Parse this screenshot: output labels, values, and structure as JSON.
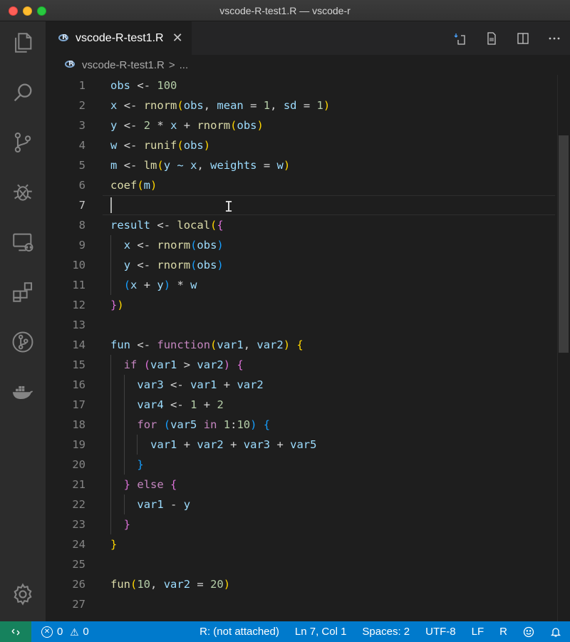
{
  "window": {
    "title": "vscode-R-test1.R — vscode-r"
  },
  "activity_bar": {
    "items": [
      {
        "icon": "files-icon"
      },
      {
        "icon": "search-icon"
      },
      {
        "icon": "source-control-icon"
      },
      {
        "icon": "debug-icon"
      },
      {
        "icon": "remote-explorer-icon"
      },
      {
        "icon": "extensions-icon"
      },
      {
        "icon": "git-graph-icon"
      },
      {
        "icon": "docker-icon"
      }
    ],
    "bottom": {
      "icon": "gear-icon"
    }
  },
  "tab": {
    "label": "vscode-R-test1.R",
    "close": "✕"
  },
  "editor_actions": [
    "run-file-icon",
    "preview-icon",
    "split-editor-icon",
    "more-actions-icon"
  ],
  "breadcrumb": {
    "file": "vscode-R-test1.R",
    "sep": ">",
    "more": "..."
  },
  "editor": {
    "current_line": 7,
    "lines": [
      "obs <- 100",
      "x <- rnorm(obs, mean = 1, sd = 1)",
      "y <- 2 * x + rnorm(obs)",
      "w <- runif(obs)",
      "m <- lm(y ~ x, weights = w)",
      "coef(m)",
      "",
      "result <- local({",
      "  x <- rnorm(obs)",
      "  y <- rnorm(obs)",
      "  (x + y) * w",
      "})",
      "",
      "fun <- function(var1, var2) {",
      "  if (var1 > var2) {",
      "    var3 <- var1 + var2",
      "    var4 <- 1 + 2",
      "    for (var5 in 1:10) {",
      "      var1 + var2 + var3 + var5",
      "    }",
      "  } else {",
      "    var1 - y",
      "  }",
      "}",
      "",
      "fun(10, var2 = 20)",
      ""
    ]
  },
  "status_bar": {
    "remote_icon": "remote-icon",
    "errors": "0",
    "warnings": "0",
    "r_status": "R: (not attached)",
    "position": "Ln 7, Col 1",
    "spaces": "Spaces: 2",
    "encoding": "UTF-8",
    "eol": "LF",
    "language": "R",
    "feedback_icon": "smiley-icon",
    "notifications_icon": "bell-icon"
  },
  "colors": {
    "status_bar": "#007acc",
    "remote_badge": "#16825d",
    "editor_bg": "#1e1e1e",
    "variable": "#9cdcfe",
    "function": "#dcdcaa",
    "number": "#b5cea8",
    "keyword": "#c586c0",
    "bracket_1": "#ffd700",
    "bracket_2": "#da70d6",
    "bracket_3": "#179fff"
  }
}
